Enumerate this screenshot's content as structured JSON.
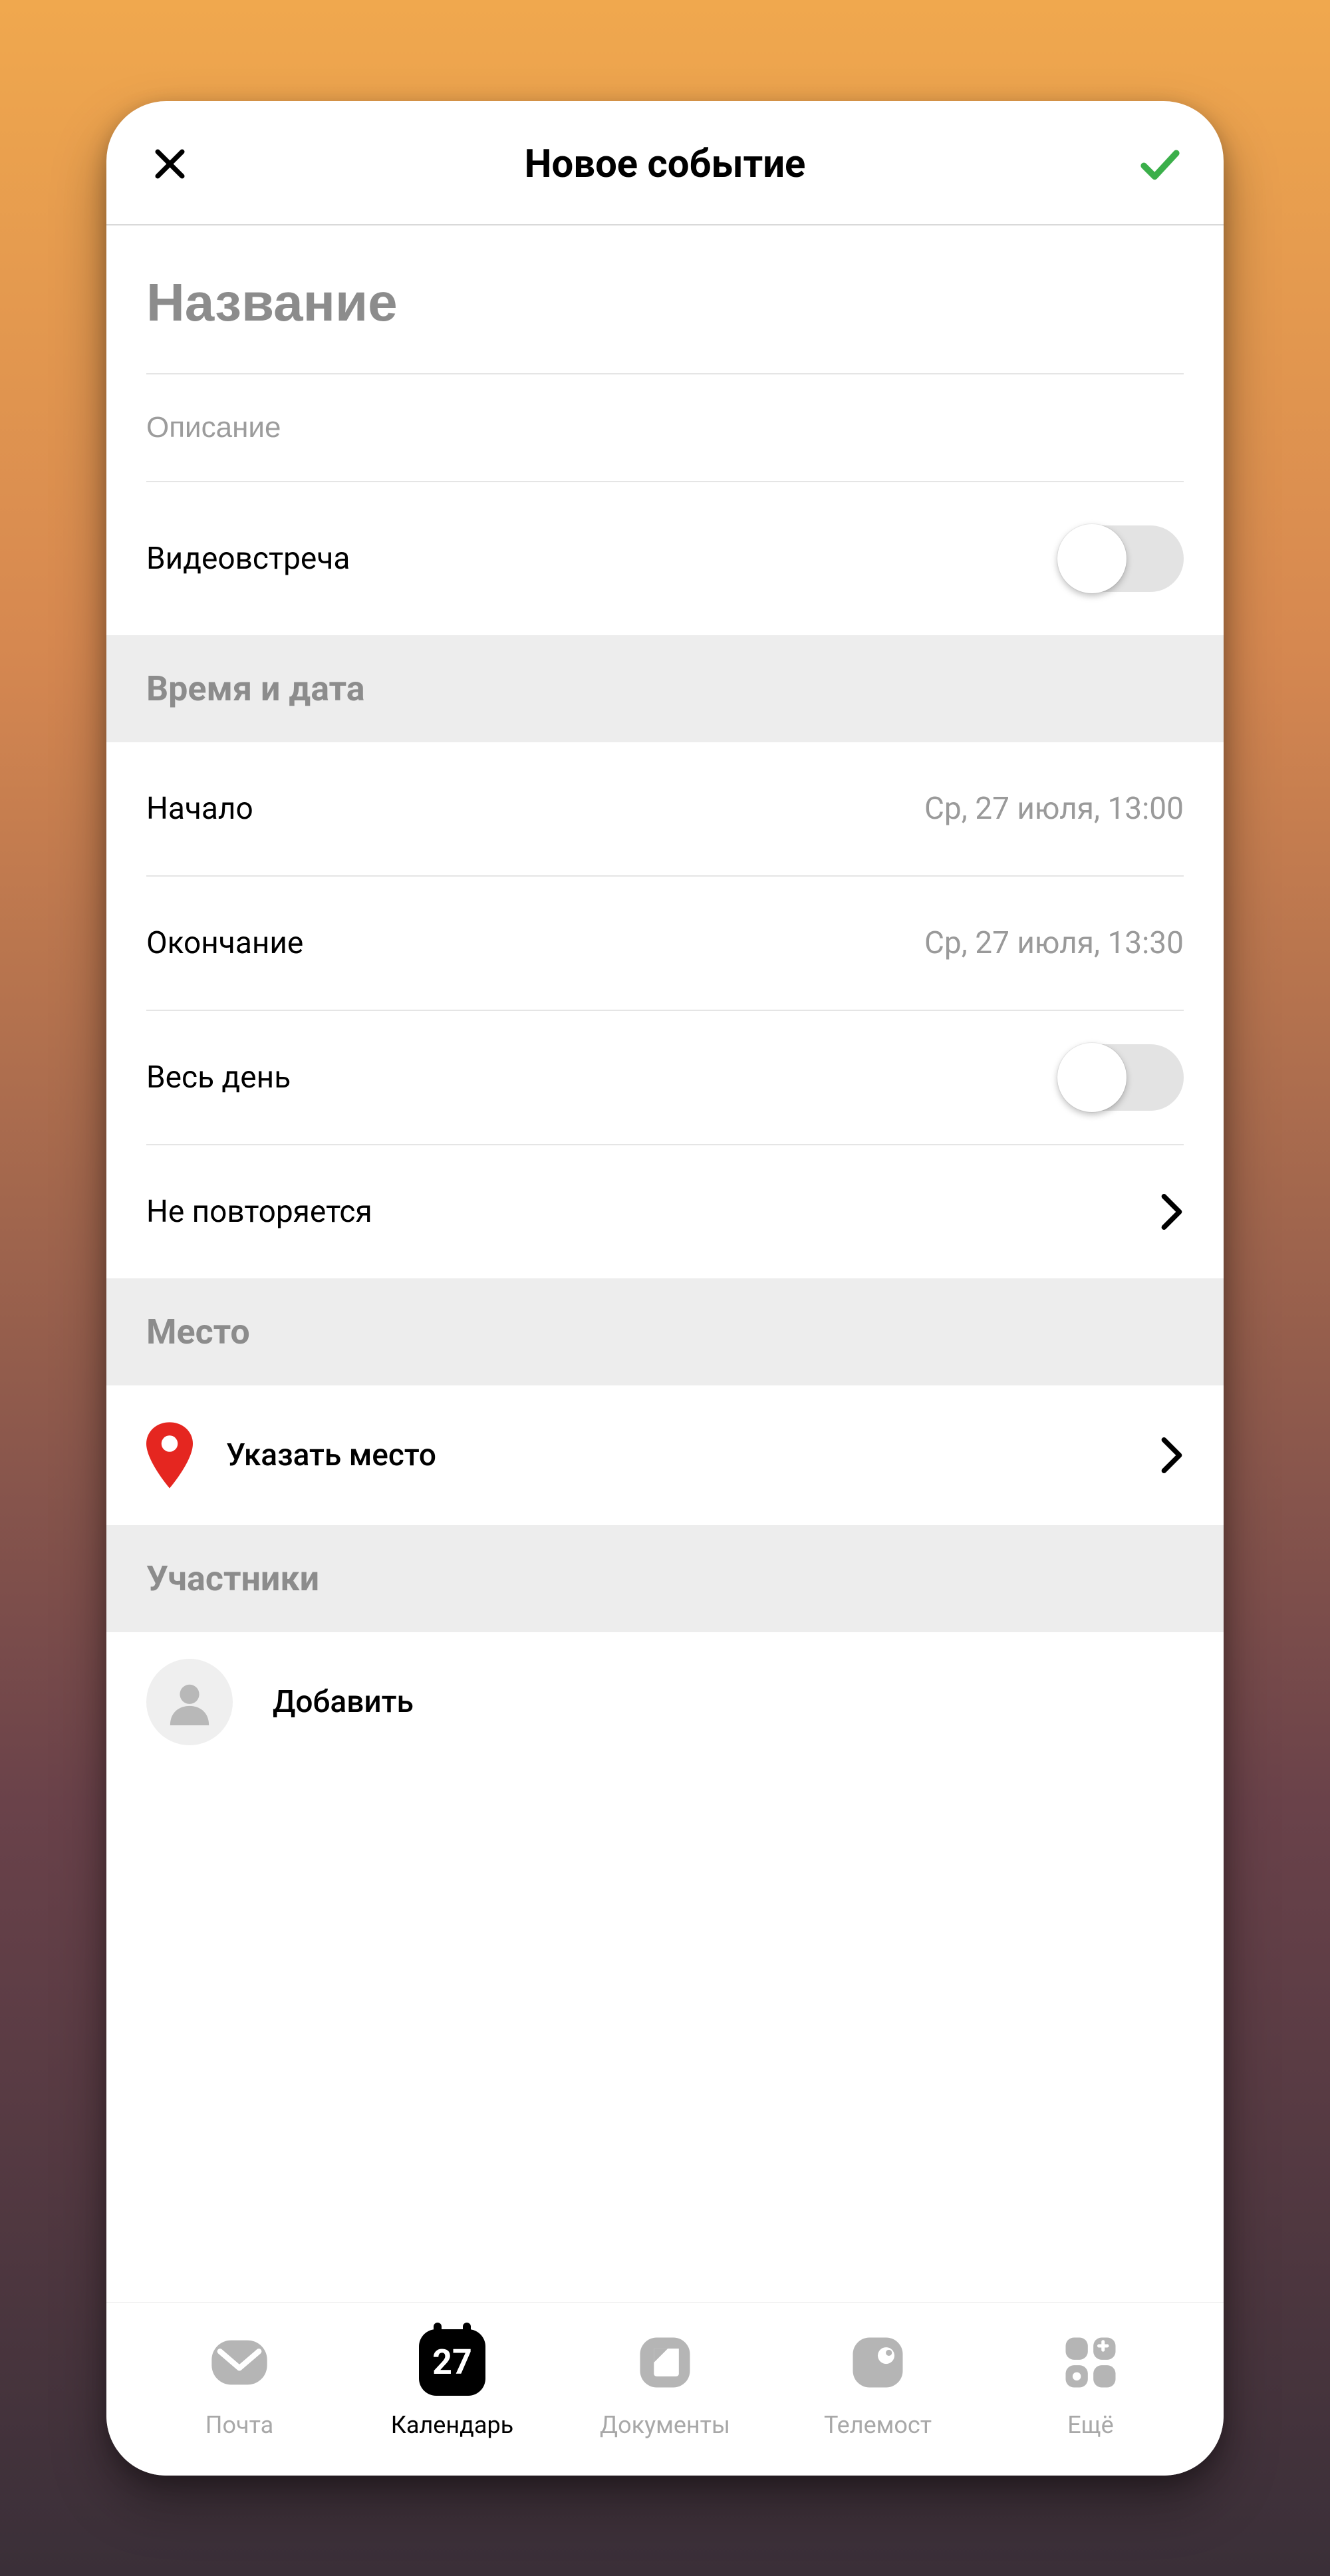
{
  "header": {
    "title": "Новое событие"
  },
  "form": {
    "title_placeholder": "Название",
    "description_placeholder": "Описание",
    "video_meeting_label": "Видеовстреча"
  },
  "datetime": {
    "section_title": "Время и дата",
    "start_label": "Начало",
    "start_value": "Ср, 27 июля, 13:00",
    "end_label": "Окончание",
    "end_value": "Ср, 27 июля, 13:30",
    "all_day_label": "Весь день",
    "repeat_label": "Не повторяется"
  },
  "location": {
    "section_title": "Место",
    "set_location_label": "Указать место"
  },
  "participants": {
    "section_title": "Участники",
    "add_label": "Добавить"
  },
  "nav": {
    "mail": "Почта",
    "calendar": "Календарь",
    "calendar_day": "27",
    "documents": "Документы",
    "telemost": "Телемост",
    "more": "Ещё"
  }
}
